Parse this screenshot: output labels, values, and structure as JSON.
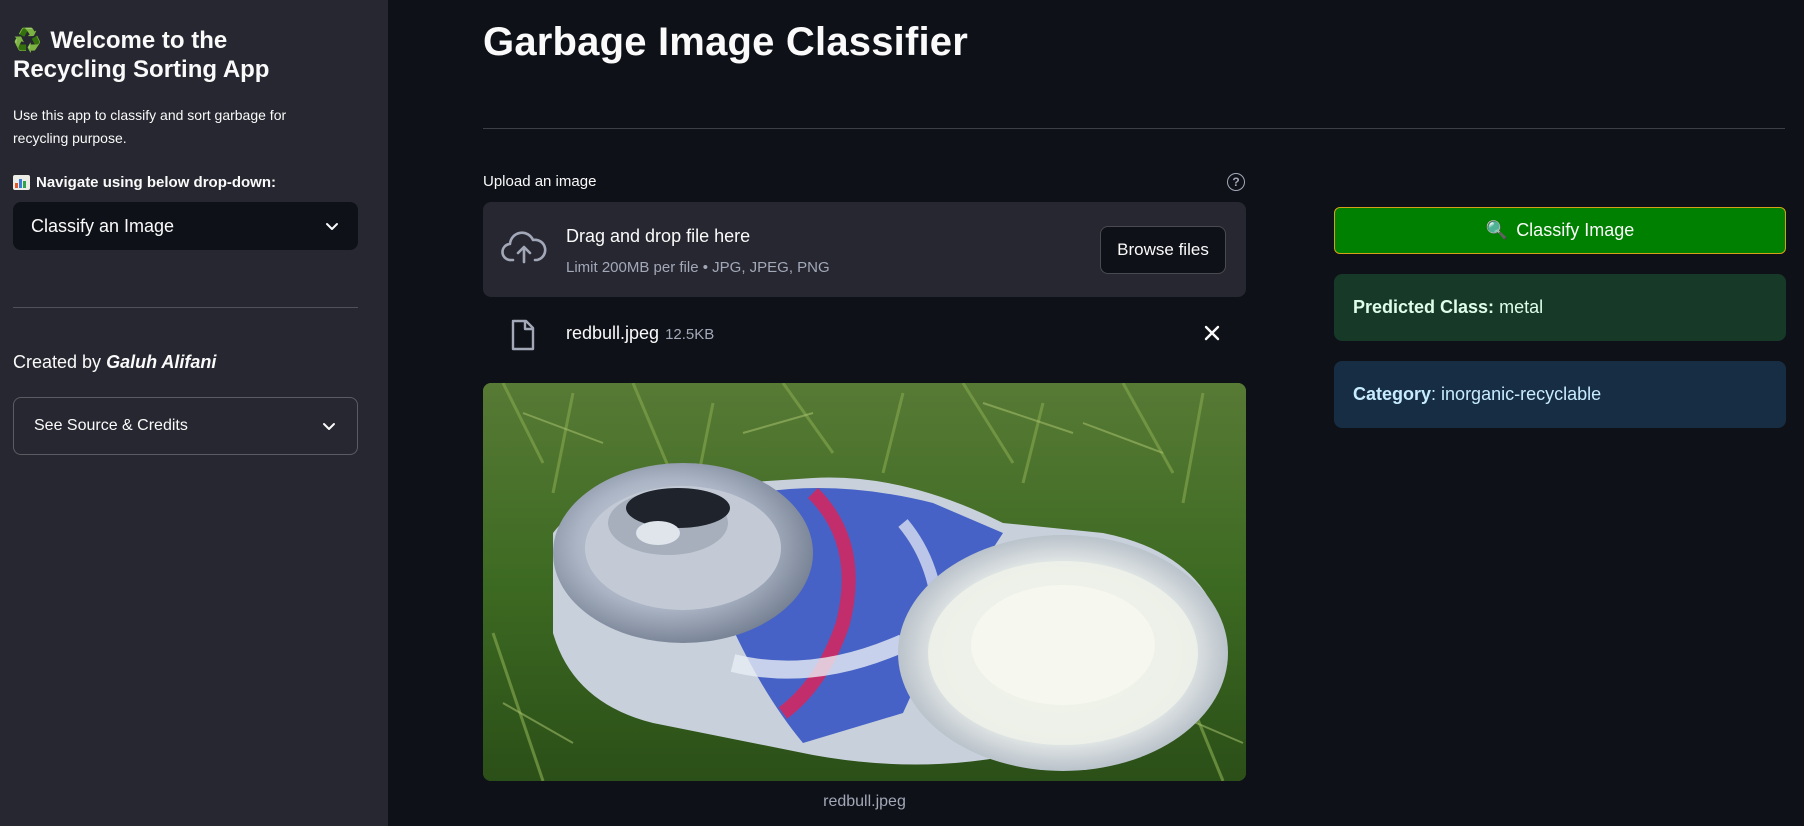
{
  "sidebar": {
    "title_emoji": "♻️",
    "title": "Welcome to the Recycling Sorting App",
    "description": "Use this app to classify and sort garbage for recycling purpose.",
    "nav_label": "Navigate using below drop-down:",
    "select_value": "Classify an Image",
    "created_prefix": "Created by",
    "created_author": "Galuh Alifani",
    "expander_label": "See Source & Credits"
  },
  "main": {
    "title": "Garbage Image Classifier",
    "uploader": {
      "label": "Upload an image",
      "help_icon": "?",
      "drop_text": "Drag and drop file here",
      "limit_text": "Limit 200MB per file • JPG, JPEG, PNG",
      "browse_label": "Browse files"
    },
    "file": {
      "name": "redbull.jpeg",
      "size": "12.5KB"
    },
    "image_caption": "redbull.jpeg"
  },
  "results": {
    "classify_icon": "🔍",
    "classify_label": "Classify Image",
    "predicted_label": "Predicted Class:",
    "predicted_value": "metal",
    "category_label": "Category",
    "category_value": "inorganic-recyclable"
  },
  "colors": {
    "background": "#0e1117",
    "sidebar": "#262730",
    "classify_button": "#008000",
    "success_bg": "#173928",
    "info_bg": "#172d43"
  }
}
